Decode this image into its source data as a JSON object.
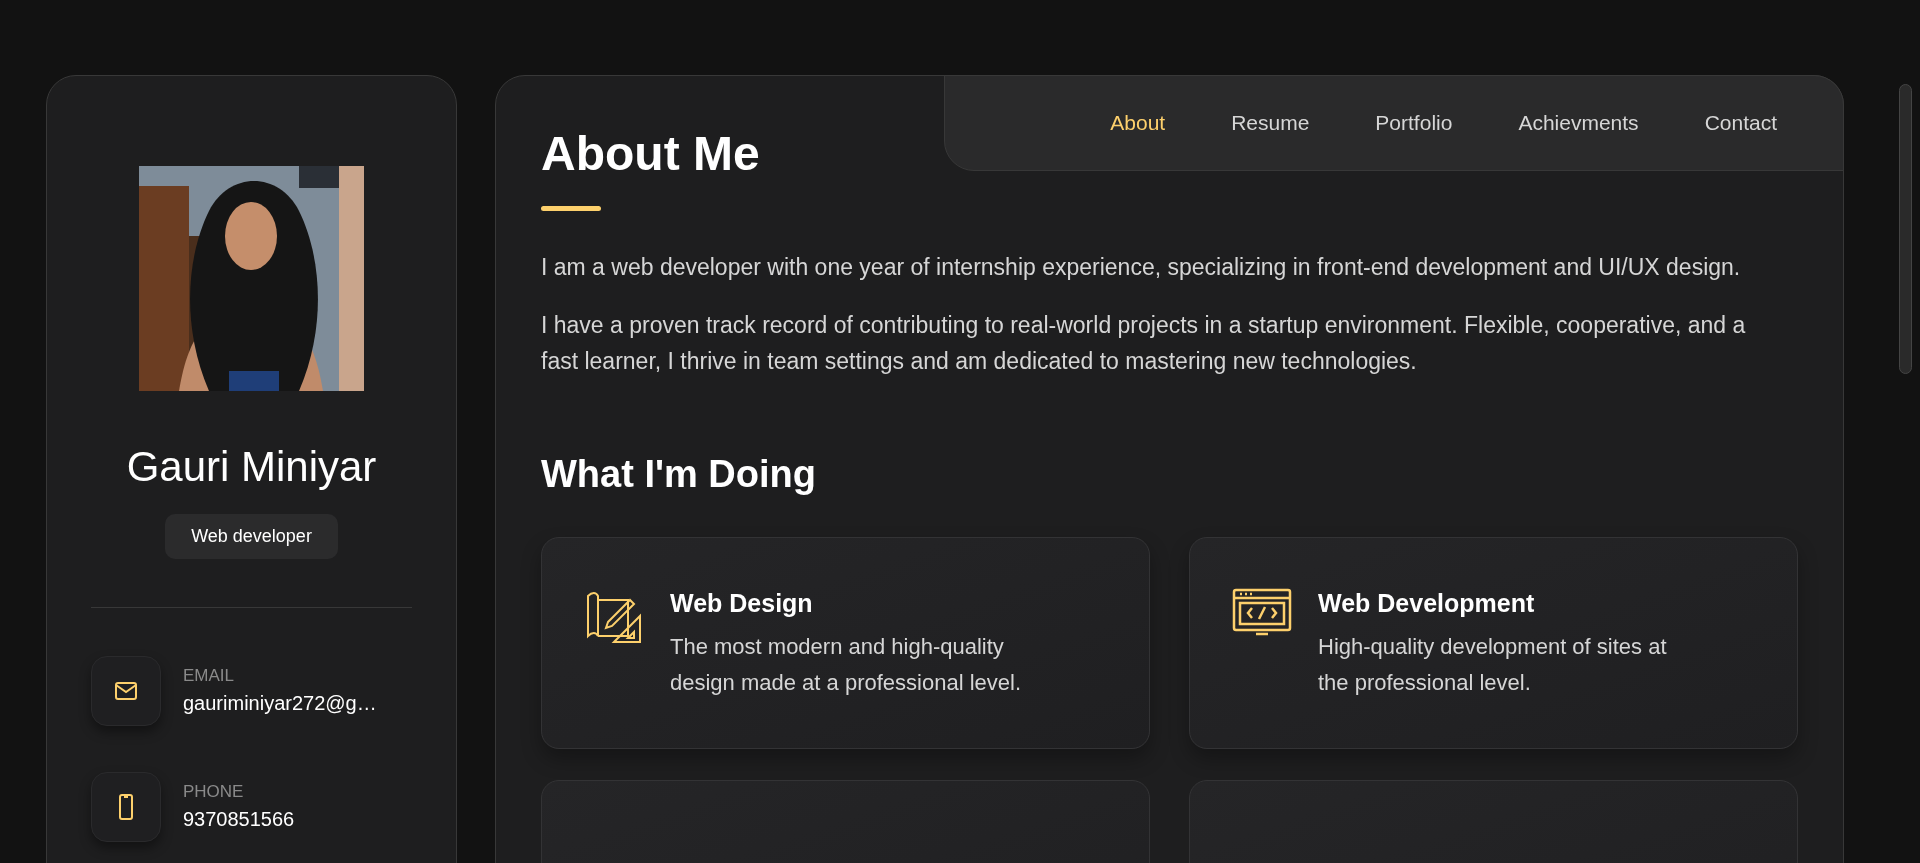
{
  "profile": {
    "kind": "picture",
    "name": "Gauri Miniyar",
    "role": "Web developer"
  },
  "contacts": [
    {
      "kind": "email",
      "label": "EMAIL",
      "value": "gauriminiyar272@g…"
    },
    {
      "kind": "phone",
      "label": "PHONE",
      "value": "9370851566"
    }
  ],
  "nav": [
    {
      "label": "About",
      "selected": true
    },
    {
      "label": "Resume",
      "selected": false
    },
    {
      "label": "Portfolio",
      "selected": false
    },
    {
      "label": "Achievments",
      "selected": false
    },
    {
      "label": "Contact",
      "selected": false
    }
  ],
  "title": "About Me",
  "paragraphs": [
    "I am a web developer with one year of internship experience, specializing in front-end development and UI/UX design.",
    "I have a proven track record of contributing to real-world projects in a startup environment. Flexible, cooperative, and a fast learner, I thrive in team settings and am dedicated to mastering new technologies."
  ],
  "services_title": "What I'm Doing",
  "services": [
    {
      "kind": "design",
      "title": "Web Design",
      "text": "The most modern and high-quality design made at a professional level."
    },
    {
      "kind": "development",
      "title": "Web Development",
      "text": "High-quality development of sites at the professional level."
    },
    {
      "kind": "cut_off"
    },
    {
      "kind": "cut_off"
    }
  ]
}
